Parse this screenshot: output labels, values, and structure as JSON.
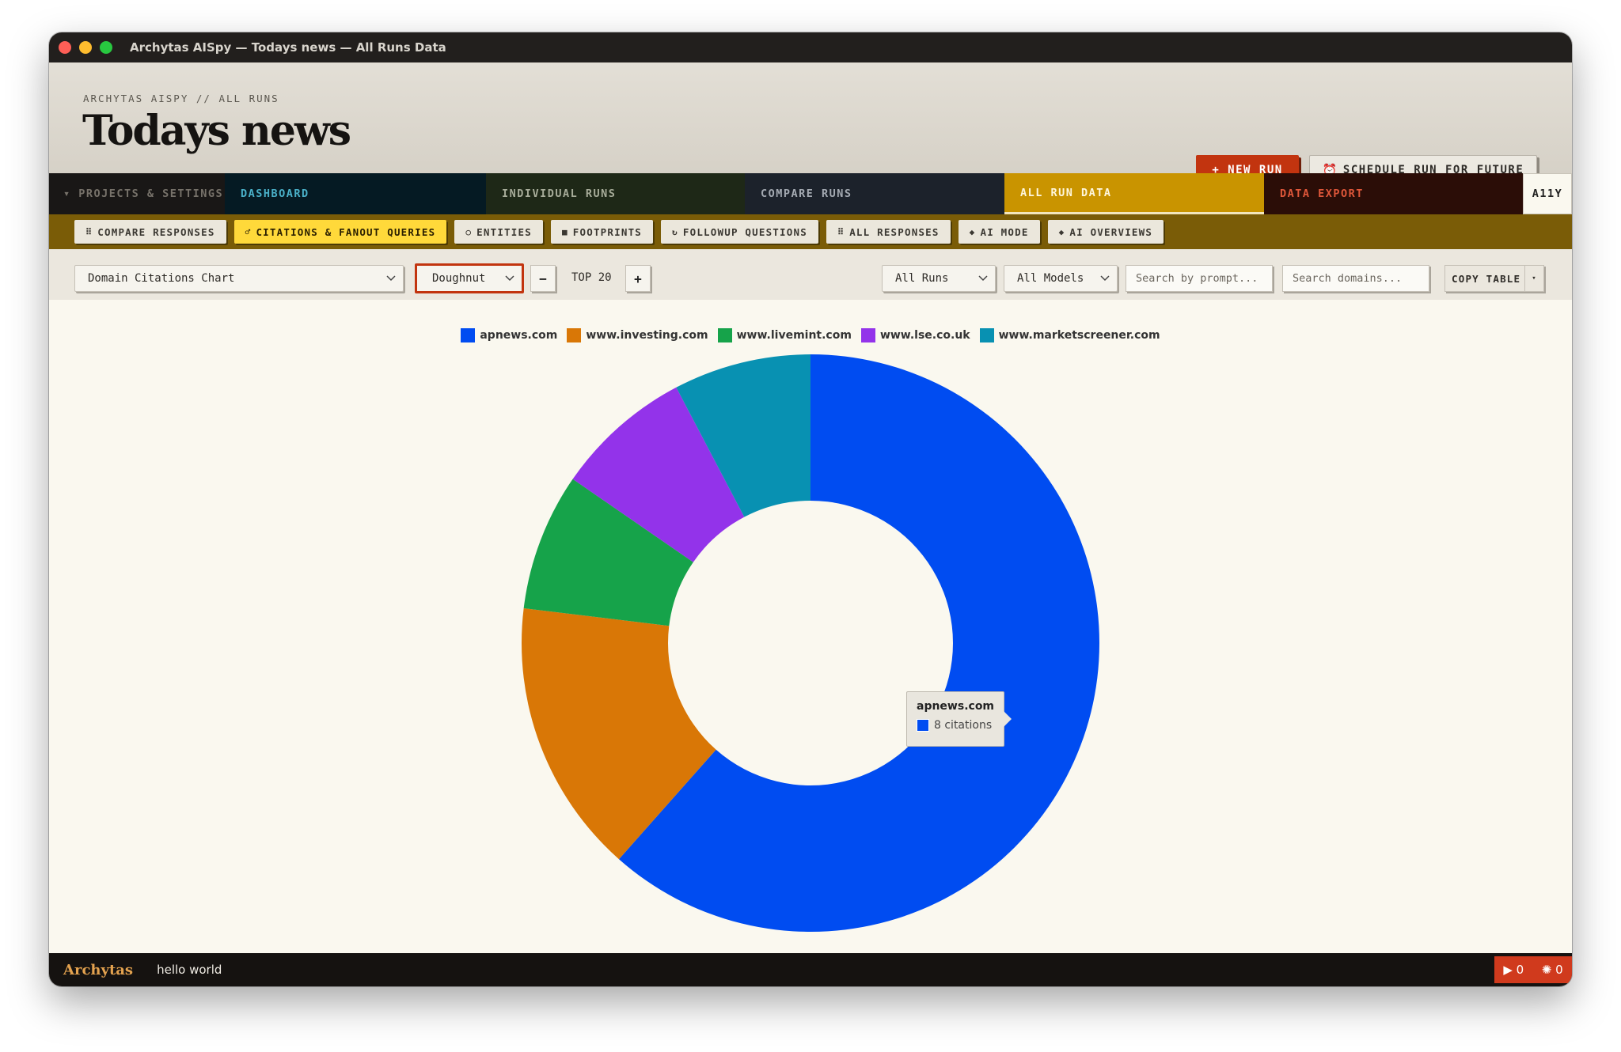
{
  "window": {
    "title": "Archytas AISpy — Todays news — All Runs Data"
  },
  "header": {
    "breadcrumb": "ARCHYTAS AISPY // ALL RUNS",
    "title": "Todays news",
    "new_run_label": "+ NEW RUN",
    "schedule_label": "SCHEDULE RUN FOR FUTURE"
  },
  "nav": {
    "projects": "▾ PROJECTS & SETTINGS",
    "dashboard": "DASHBOARD",
    "individual": "INDIVIDUAL RUNS",
    "compare": "COMPARE RUNS",
    "all_data": "ALL RUN DATA",
    "export": "DATA EXPORT",
    "a11y": "A11Y"
  },
  "subtabs": [
    {
      "icon": "⠿",
      "label": "COMPARE RESPONSES"
    },
    {
      "icon": "♂",
      "label": "CITATIONS & FANOUT QUERIES"
    },
    {
      "icon": "○",
      "label": "ENTITIES"
    },
    {
      "icon": "■",
      "label": "FOOTPRINTS"
    },
    {
      "icon": "↻",
      "label": "FOLLOWUP QUESTIONS"
    },
    {
      "icon": "⠿",
      "label": "ALL RESPONSES"
    },
    {
      "icon": "◆",
      "label": "AI MODE"
    },
    {
      "icon": "◆",
      "label": "AI OVERVIEWS"
    }
  ],
  "toolbar": {
    "chart_select": "Domain Citations Chart",
    "type_select": "Doughnut",
    "minus": "−",
    "top_n": "TOP 20",
    "plus": "+",
    "runs_select": "All Runs",
    "models_select": "All Models",
    "search_prompt_placeholder": "Search by prompt...",
    "search_domain_placeholder": "Search domains...",
    "copy_label": "COPY TABLE",
    "copy_caret": "▾"
  },
  "colors": {
    "apnews": "#004cf1",
    "investing": "#d97706",
    "livemint": "#16a34a",
    "lse": "#9333ea",
    "marketscreener": "#0891b2"
  },
  "chart_data": {
    "type": "pie",
    "variant": "doughnut",
    "categories": [
      "apnews.com",
      "www.investing.com",
      "www.livemint.com",
      "www.lse.co.uk",
      "www.marketscreener.com"
    ],
    "values": [
      8,
      2,
      1,
      1,
      1
    ],
    "legend_position": "top",
    "tooltip": {
      "label": "apnews.com",
      "value_text": "8 citations"
    }
  },
  "statusbar": {
    "brand": "Archytas",
    "message": "hello world",
    "play_count": "▶ 0",
    "bug_count": "✺ 0"
  }
}
